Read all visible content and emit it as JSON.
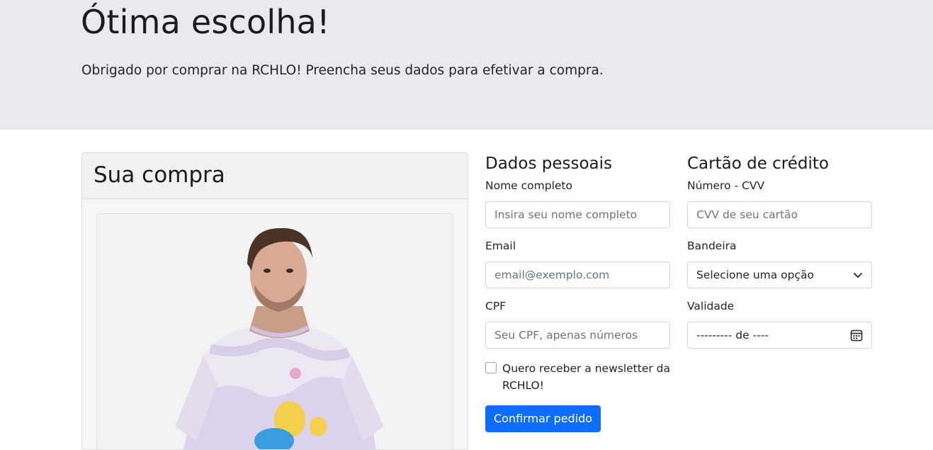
{
  "hero": {
    "title": "Ótima escolha!",
    "subtitle": "Obrigado por comprar na RCHLO! Preencha seus dados para efetivar a compra."
  },
  "purchase": {
    "title": "Sua compra"
  },
  "personal": {
    "title": "Dados pessoais",
    "name_label": "Nome completo",
    "name_placeholder": "Insira seu nome completo",
    "email_label": "Email",
    "email_placeholder": "email@exemplo.com",
    "cpf_label": "CPF",
    "cpf_placeholder": "Seu CPF, apenas números",
    "newsletter_label": "Quero receber a newsletter da RCHLO!",
    "confirm_label": "Confirmar pedido"
  },
  "card": {
    "title": "Cartão de crédito",
    "number_label": "Número - CVV",
    "number_placeholder": "CVV de seu cartão",
    "brand_label": "Bandeira",
    "brand_selected": "Selecione uma opção",
    "validity_label": "Validade",
    "validity_value": "--------- de ----"
  },
  "colors": {
    "hero_bg": "#ebe9ef",
    "primary": "#0d6efd"
  },
  "icons": [
    "chevron-down-icon",
    "calendar-icon"
  ]
}
